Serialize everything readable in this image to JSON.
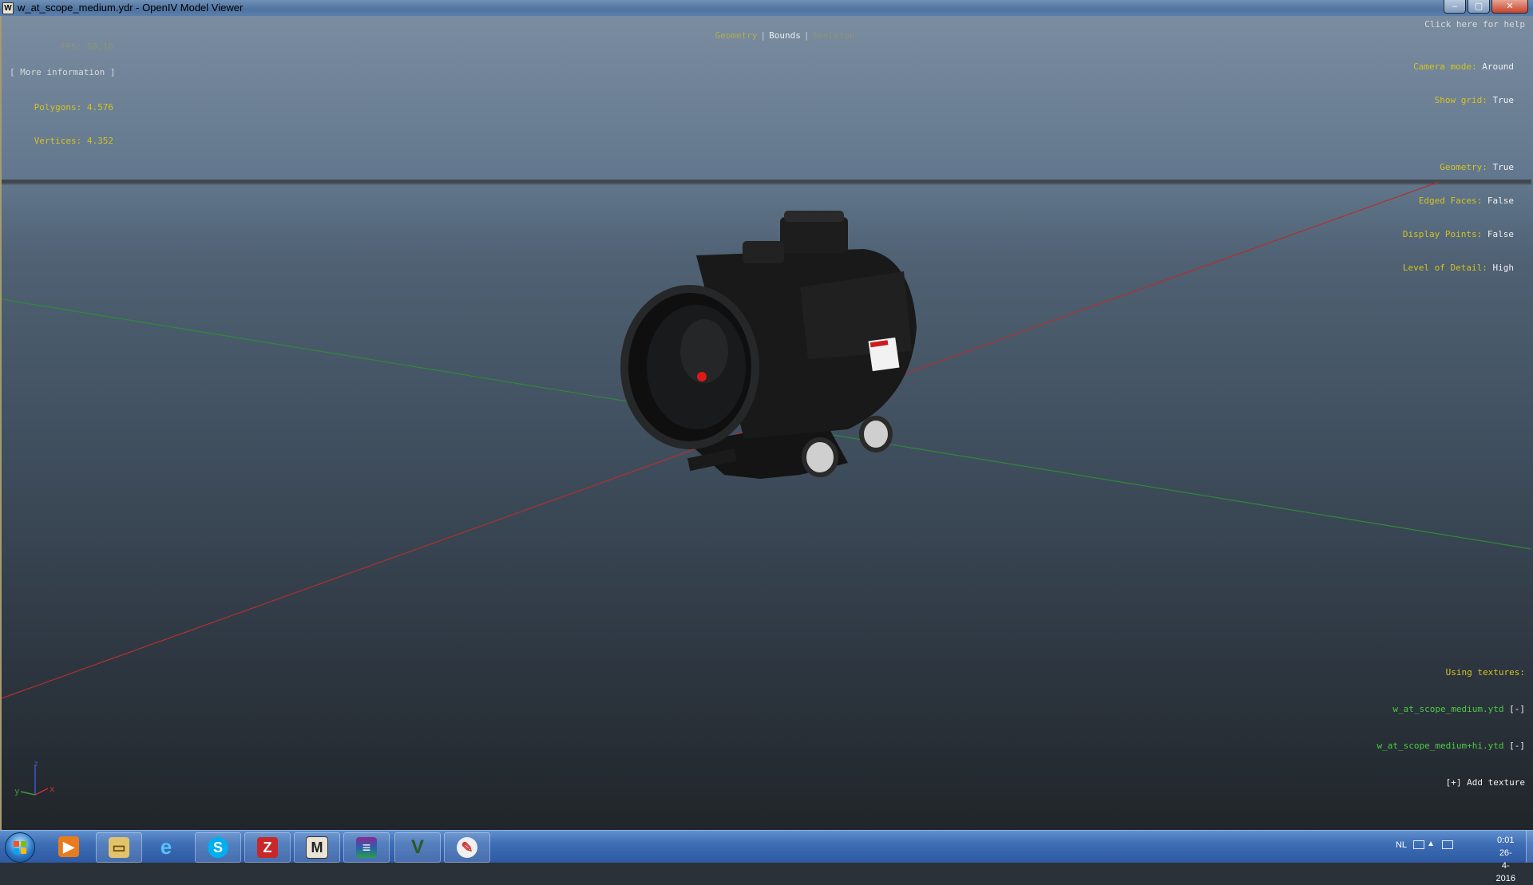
{
  "window": {
    "title": "w_at_scope_medium.ydr - OpenIV Model Viewer",
    "icon": "openiv-app-icon"
  },
  "window_buttons": {
    "minimize": "‒",
    "maximize": "▢",
    "close": "✕"
  },
  "hud": {
    "fps": "FPS: 60,16",
    "polygons": "Polygons: 4.576",
    "vertices": "Vertices: 4.352",
    "more_info": "[ More information ]",
    "tabs": [
      "Geometry",
      "Bounds",
      "Skeleton"
    ],
    "separator": "|",
    "help": "Click here for help",
    "settings": [
      {
        "label": "Camera mode:",
        "value": "Around"
      },
      {
        "label": "Show grid:",
        "value": "True"
      },
      {
        "label": "Geometry:",
        "value": "True"
      },
      {
        "label": "Edged Faces:",
        "value": "False"
      },
      {
        "label": "Display Points:",
        "value": "False"
      },
      {
        "label": "Level of Detail:",
        "value": "High"
      }
    ]
  },
  "textures": {
    "title": "Using textures:",
    "items": [
      {
        "name": "w_at_scope_medium.ytd",
        "action": "[-]"
      },
      {
        "name": "w_at_scope_medium+hi.ytd",
        "action": "[-]"
      }
    ],
    "add": "[+] Add texture"
  },
  "axis_gizmo": {
    "y": "y",
    "x": "x",
    "z": "z"
  },
  "taskbar": {
    "apps": [
      "start-orb",
      "media-player-icon",
      "file-explorer-icon",
      "internet-explorer-icon",
      "skype-icon",
      "red-app-icon",
      "openiv-icon",
      "winrar-icon",
      "gta-v-icon",
      "paint-icon"
    ],
    "skype_letter": "S",
    "ie_letter": "e",
    "openiv_letter": "M",
    "gta_letter": "V"
  },
  "tray": {
    "language": "NL",
    "time": "0:01",
    "date": "26-4-2016",
    "up_arrow": "▲"
  },
  "colors": {
    "hud_yellow": "#d4c21f",
    "texture_green": "#4fc947",
    "grid_red": "#b03030",
    "grid_green": "#2f8a35"
  }
}
